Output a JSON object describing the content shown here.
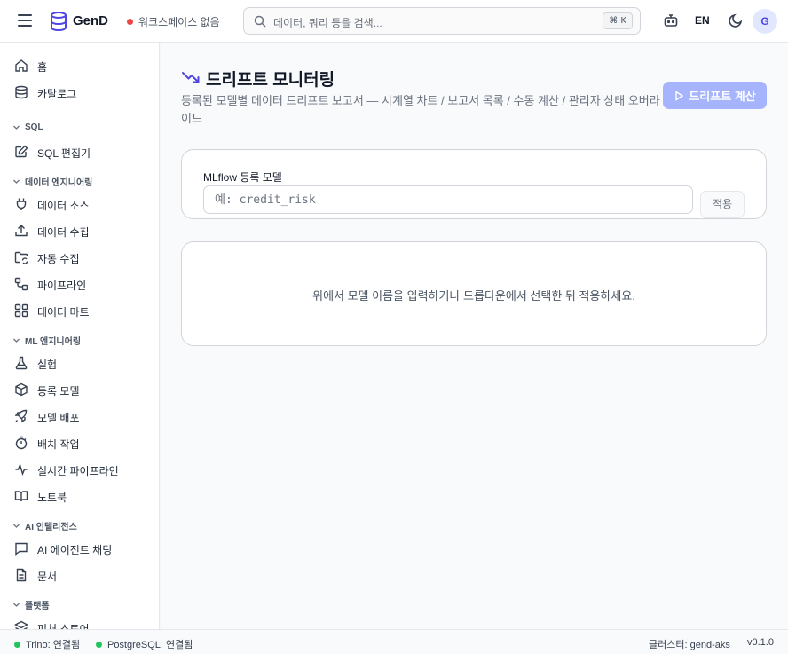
{
  "topbar": {
    "brand": "GenD",
    "workspace_status": "워크스페이스 없음",
    "search_placeholder": "데이터, 쿼리 등을 검색...",
    "search_shortcut": "⌘ K",
    "language": "EN",
    "avatar_initial": "G",
    "status_color": "#ef4444"
  },
  "sidebar": {
    "items": [
      {
        "label": "홈",
        "icon": "home-icon"
      },
      {
        "label": "카탈로그",
        "icon": "database-icon"
      }
    ],
    "sections": [
      {
        "title": "SQL",
        "items": [
          {
            "label": "SQL 편집기",
            "icon": "edit-icon"
          }
        ]
      },
      {
        "title": "데이터 엔지니어링",
        "items": [
          {
            "label": "데이터 소스",
            "icon": "plug-icon"
          },
          {
            "label": "데이터 수집",
            "icon": "upload-icon"
          },
          {
            "label": "자동 수집",
            "icon": "folder-sync-icon"
          },
          {
            "label": "파이프라인",
            "icon": "workflow-icon"
          },
          {
            "label": "데이터 마트",
            "icon": "grid-icon"
          }
        ]
      },
      {
        "title": "ML 엔지니어링",
        "items": [
          {
            "label": "실험",
            "icon": "flask-icon"
          },
          {
            "label": "등록 모델",
            "icon": "box-icon"
          },
          {
            "label": "모델 배포",
            "icon": "rocket-icon"
          },
          {
            "label": "배치 작업",
            "icon": "timer-icon"
          },
          {
            "label": "실시간 파이프라인",
            "icon": "activity-icon"
          },
          {
            "label": "노트북",
            "icon": "book-icon"
          }
        ]
      },
      {
        "title": "AI 인텔리전스",
        "items": [
          {
            "label": "AI 에이전트 채팅",
            "icon": "chat-icon"
          },
          {
            "label": "문서",
            "icon": "document-icon"
          }
        ]
      },
      {
        "title": "플랫폼",
        "items": [
          {
            "label": "피처 스토어",
            "icon": "layers-icon"
          }
        ]
      }
    ]
  },
  "main": {
    "title": "드리프트 모니터링",
    "subtitle": "등록된 모델별 데이터 드리프트 보고서 — 시계열 차트 / 보고서 목록 / 수동 계산 / 관리자 상태 오버라이드",
    "compute_button": "드리프트 계산",
    "form": {
      "label": "MLflow 등록 모델",
      "placeholder": "예: credit_risk",
      "value": "",
      "apply_button": "적용"
    },
    "empty_message": "위에서 모델 이름을 입력하거나 드롭다운에서 선택한 뒤 적용하세요."
  },
  "statusbar": {
    "trino": "Trino: 연결됨",
    "postgres": "PostgreSQL: 연결됨",
    "cluster": "클러스터: gend-aks",
    "version": "v0.1.0",
    "connected_color": "#22c55e"
  },
  "colors": {
    "accent": "#4f46e5",
    "accent_light": "#a5b4fc"
  }
}
